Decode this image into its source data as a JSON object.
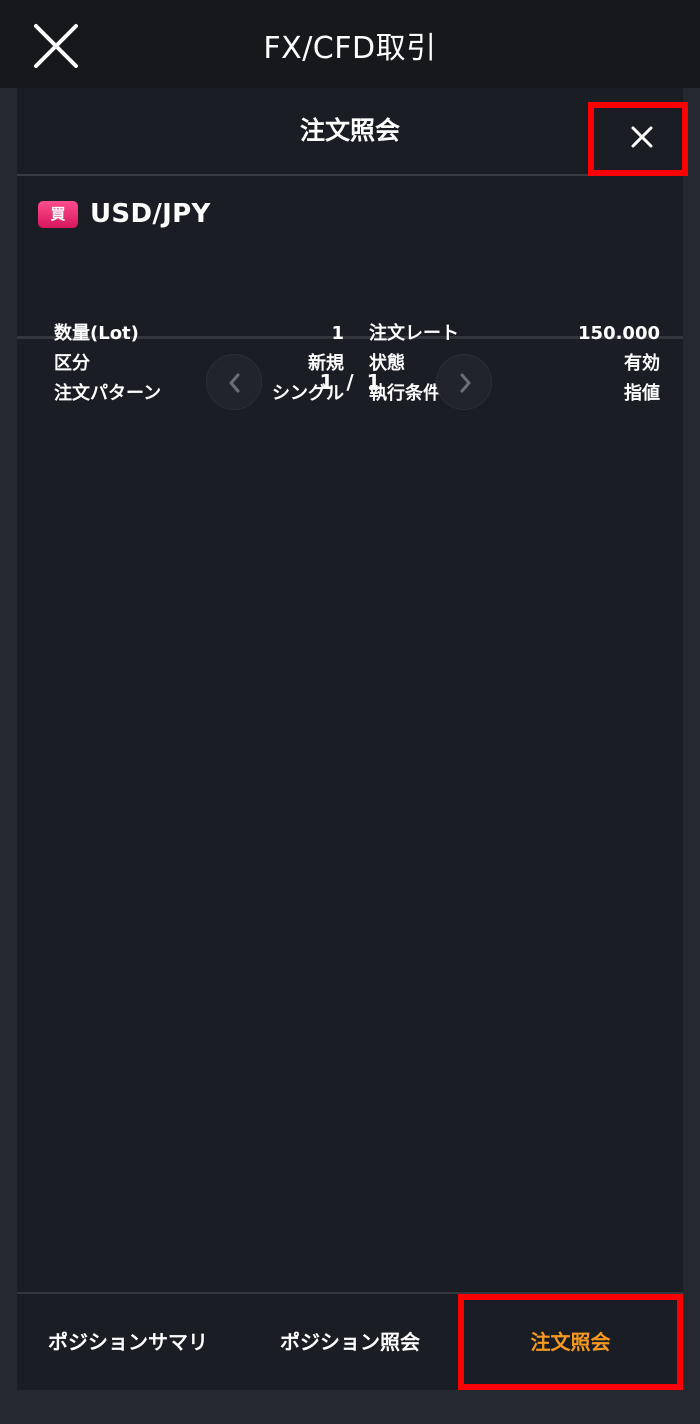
{
  "app_header": {
    "title": "FX/CFD取引",
    "close_icon": "close-icon"
  },
  "panel": {
    "title": "注文照会",
    "close_icon": "close-icon"
  },
  "order": {
    "side_badge": "買",
    "side_color": "#e8206c",
    "symbol": "USD/JPY",
    "details": [
      {
        "label": "数量(Lot)",
        "value": "1"
      },
      {
        "label": "注文レート",
        "value": "150.000"
      },
      {
        "label": "区分",
        "value": "新規"
      },
      {
        "label": "状態",
        "value": "有効"
      },
      {
        "label": "注文パターン",
        "value": "シングル"
      },
      {
        "label": "執行条件",
        "value": "指値"
      }
    ]
  },
  "pager": {
    "text": "1 / 1",
    "prev_icon": "chevron-left-icon",
    "next_icon": "chevron-right-icon"
  },
  "tabs": [
    {
      "label": "ポジションサマリ",
      "active": false
    },
    {
      "label": "ポジション照会",
      "active": false
    },
    {
      "label": "注文照会",
      "active": true
    }
  ],
  "colors": {
    "accent": "#f59a1c",
    "highlight": "#ff0000",
    "header_bg": "#17181c",
    "panel_bg": "#1b1d24"
  }
}
